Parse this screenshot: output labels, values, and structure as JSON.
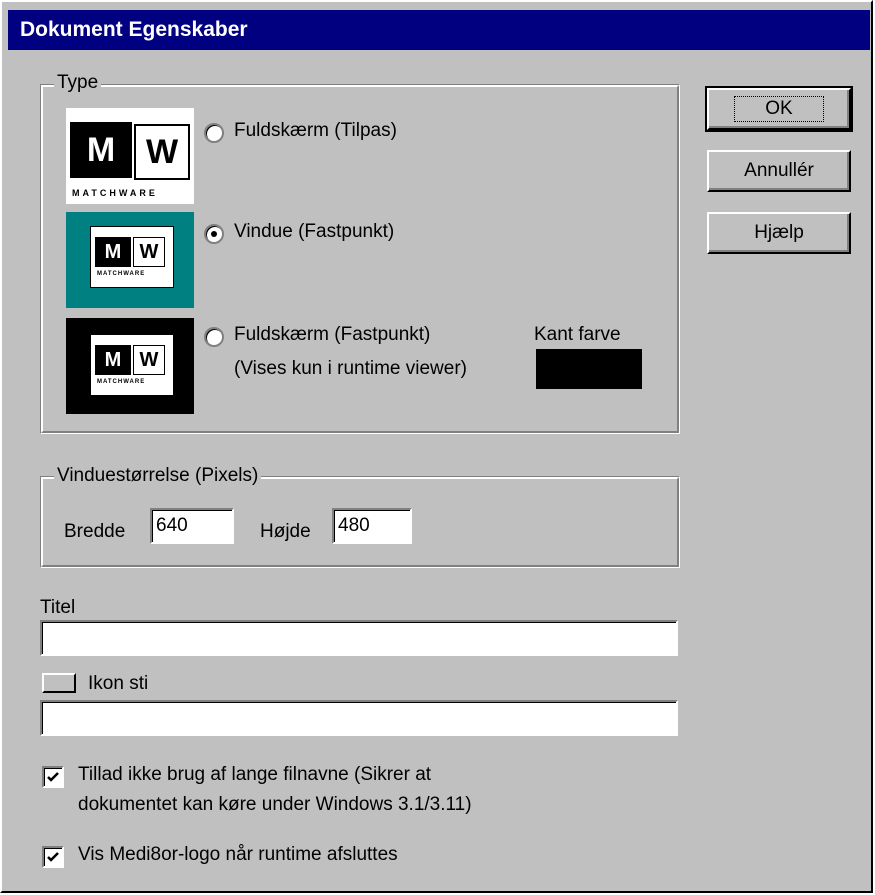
{
  "dialog": {
    "title": "Dokument Egenskaber"
  },
  "buttons": {
    "ok": "OK",
    "cancel": "Annullér",
    "help": "Hjælp"
  },
  "type_group": {
    "label": "Type",
    "options": [
      {
        "label": "Fuldskærm (Tilpas)",
        "checked": false
      },
      {
        "label": "Vindue (Fastpunkt)",
        "checked": true
      },
      {
        "label": "Fuldskærm (Fastpunkt)",
        "sublabel": "(Vises kun i runtime viewer)",
        "checked": false
      }
    ],
    "border_color_label": "Kant farve",
    "border_color": "#000000",
    "logo": {
      "m": "M",
      "w": "W",
      "word": "MATCHWARE"
    }
  },
  "window_size_group": {
    "label": "Vinduestørrelse (Pixels)",
    "width_label": "Bredde",
    "width_value": "640",
    "height_label": "Højde",
    "height_value": "480"
  },
  "title_field": {
    "label": "Titel",
    "value": ""
  },
  "icon_path_field": {
    "label": "Ikon sti",
    "value": ""
  },
  "checkboxes": [
    {
      "label_line1": "Tillad ikke brug af lange filnavne (Sikrer at",
      "label_line2": "dokumentet kan køre under Windows 3.1/3.11)",
      "checked": true
    },
    {
      "label_line1": "Vis Medi8or-logo når runtime afsluttes",
      "checked": true
    }
  ],
  "colors": {
    "titlebar": "#000080",
    "face": "#c0c0c0",
    "teal_preview": "#008080"
  }
}
